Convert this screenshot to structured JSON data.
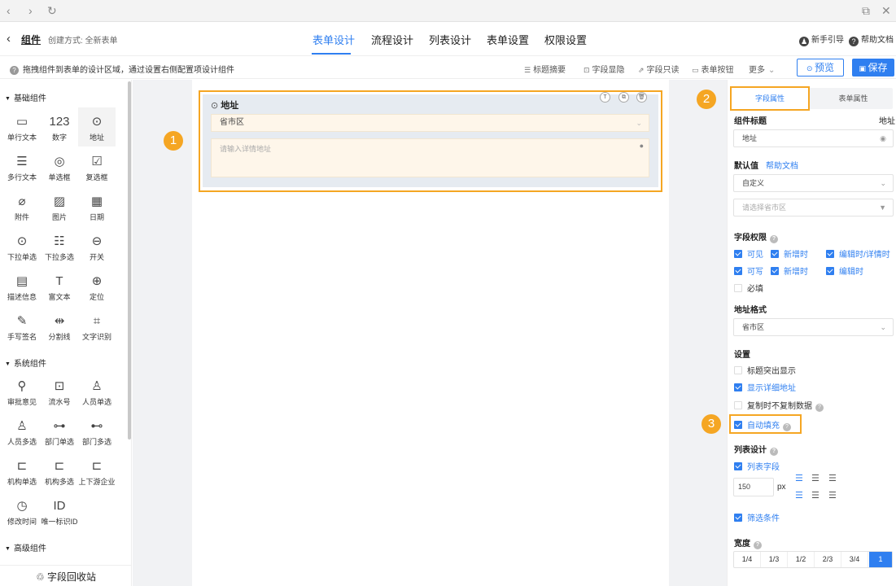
{
  "browser": {
    "back": "‹",
    "forward": "›",
    "reload": "↻",
    "copy": "⧉",
    "close": "✕"
  },
  "header": {
    "back": "‹",
    "title": "组件",
    "create_mode": "创建方式: 全新表单",
    "tabs": [
      {
        "label": "表单设计"
      },
      {
        "label": "流程设计"
      },
      {
        "label": "列表设计"
      },
      {
        "label": "表单设置"
      },
      {
        "label": "权限设置"
      }
    ],
    "guide": "新手引导",
    "docs": "帮助文档"
  },
  "toolbar": {
    "hint": "拖拽组件到表单的设计区域，通过设置右侧配置项设计组件",
    "title_summary": "标题摘要",
    "field_display": "字段显隐",
    "field_readonly": "字段只读",
    "form_buttons": "表单按钮",
    "more": "更多",
    "preview": "预览",
    "save": "保存"
  },
  "left": {
    "basic_title": "基础组件",
    "basic": [
      {
        "label": "单行文本",
        "icon": "▭"
      },
      {
        "label": "数字",
        "icon": "123"
      },
      {
        "label": "地址",
        "icon": "⊙"
      },
      {
        "label": "多行文本",
        "icon": "☰"
      },
      {
        "label": "单选框",
        "icon": "◎"
      },
      {
        "label": "复选框",
        "icon": "☑"
      },
      {
        "label": "附件",
        "icon": "⌀"
      },
      {
        "label": "图片",
        "icon": "▨"
      },
      {
        "label": "日期",
        "icon": "▦"
      },
      {
        "label": "下拉单选",
        "icon": "⊙"
      },
      {
        "label": "下拉多选",
        "icon": "☷"
      },
      {
        "label": "开关",
        "icon": "⊖"
      },
      {
        "label": "描述信息",
        "icon": "▤"
      },
      {
        "label": "富文本",
        "icon": "T"
      },
      {
        "label": "定位",
        "icon": "⊕"
      },
      {
        "label": "手写签名",
        "icon": "✎"
      },
      {
        "label": "分割线",
        "icon": "⇹"
      },
      {
        "label": "文字识别",
        "icon": "⌗"
      }
    ],
    "system_title": "系统组件",
    "system": [
      {
        "label": "审批意见",
        "icon": "⚲"
      },
      {
        "label": "流水号",
        "icon": "⊡"
      },
      {
        "label": "人员单选",
        "icon": "♙"
      },
      {
        "label": "人员多选",
        "icon": "♙"
      },
      {
        "label": "部门单选",
        "icon": "⊶"
      },
      {
        "label": "部门多选",
        "icon": "⊷"
      },
      {
        "label": "机构单选",
        "icon": "⊏"
      },
      {
        "label": "机构多选",
        "icon": "⊏"
      },
      {
        "label": "上下游企业",
        "icon": "⊏"
      },
      {
        "label": "修改时间",
        "icon": "◷"
      },
      {
        "label": "唯一标识ID",
        "icon": "ID"
      }
    ],
    "advanced_title": "高级组件",
    "recycle": "字段回收站"
  },
  "canvas": {
    "field_label": "地址",
    "select_value": "省市区",
    "detail_placeholder": "请输入详情地址"
  },
  "badges": [
    "1",
    "2",
    "3"
  ],
  "right": {
    "tab_field": "字段属性",
    "tab_form": "表单属性",
    "title_label": "组件标题",
    "title_value": "地址",
    "title_input": "地址",
    "default_label": "默认值",
    "help_doc": "帮助文档",
    "default_mode": "自定义",
    "default_placeholder": "请选择省市区",
    "perm_label": "字段权限",
    "perm": {
      "visible": "可见",
      "new1": "新增时",
      "edit_detail": "编辑时/详情时",
      "writable": "可写",
      "new2": "新增时",
      "edit": "编辑时",
      "required": "必填"
    },
    "format_label": "地址格式",
    "format_value": "省市区",
    "settings_label": "设置",
    "settings": {
      "highlight": "标题突出显示",
      "show_detail": "显示详细地址",
      "no_copy": "复制时不复制数据",
      "autofill": "自动填充"
    },
    "list_label": "列表设计",
    "list_field": "列表字段",
    "width_value": "150",
    "px": "px",
    "filter": "筛选条件",
    "width_label": "宽度",
    "widths": [
      "1/4",
      "1/3",
      "1/2",
      "2/3",
      "3/4",
      "1"
    ]
  }
}
